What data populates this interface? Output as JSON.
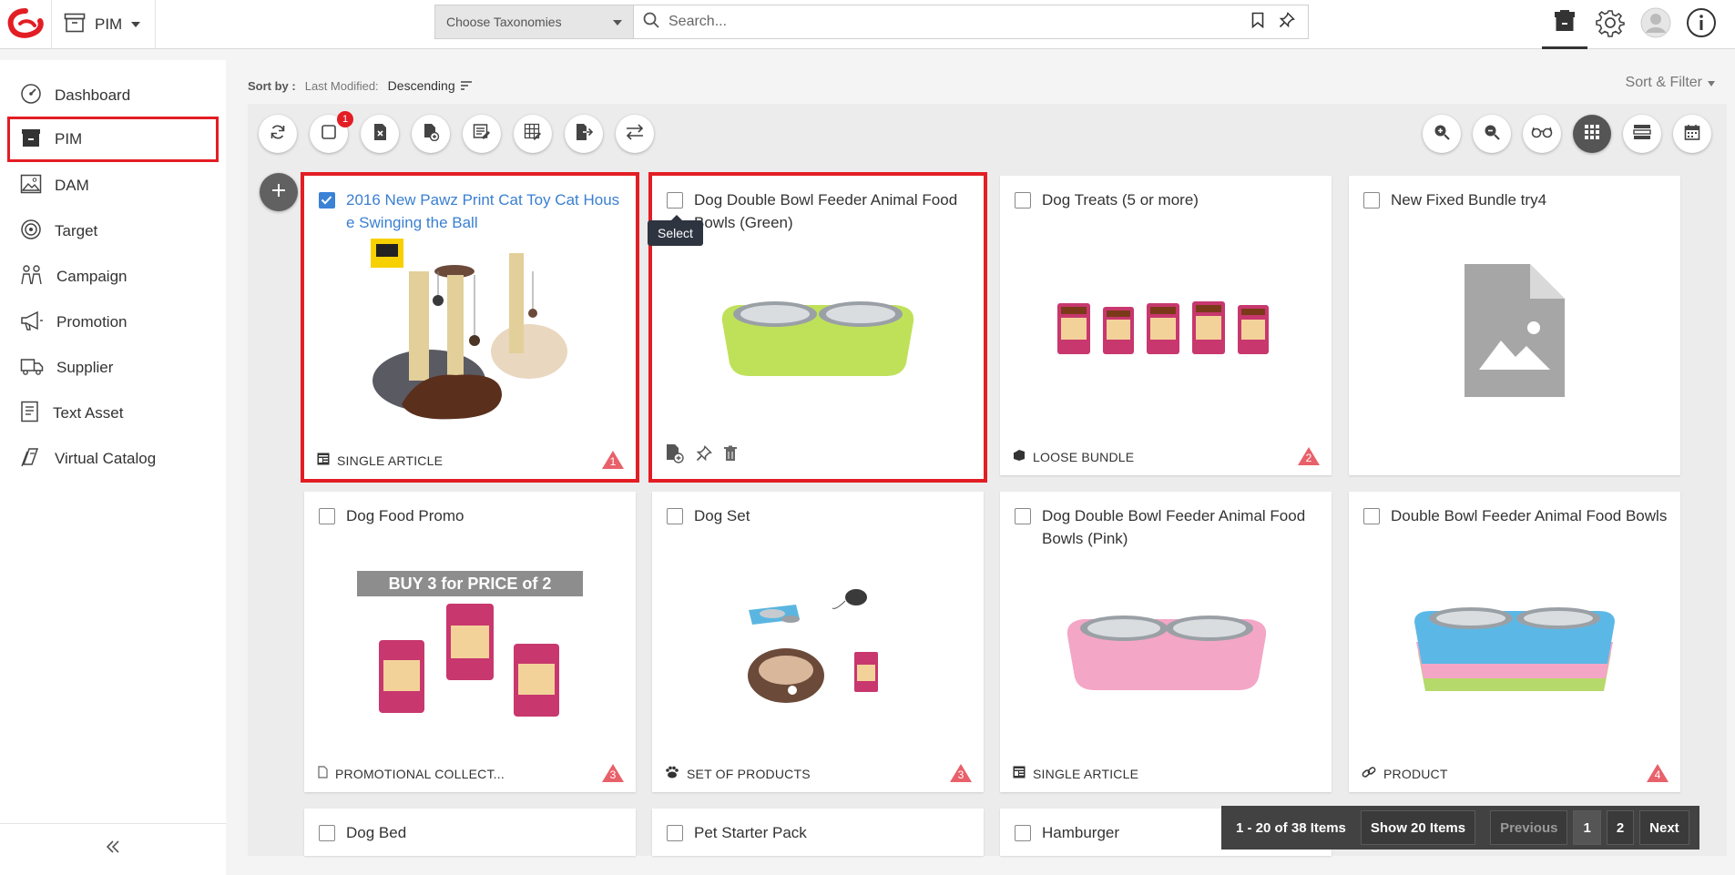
{
  "header": {
    "module_label": "PIM",
    "taxonomy_placeholder": "Choose Taxonomies",
    "search_placeholder": "Search..."
  },
  "sidebar": {
    "items": [
      {
        "label": "Dashboard",
        "icon": "dashboard-icon"
      },
      {
        "label": "PIM",
        "icon": "pim-icon",
        "selected": true
      },
      {
        "label": "DAM",
        "icon": "image-icon"
      },
      {
        "label": "Target",
        "icon": "target-icon"
      },
      {
        "label": "Campaign",
        "icon": "campaign-icon"
      },
      {
        "label": "Promotion",
        "icon": "megaphone-icon"
      },
      {
        "label": "Supplier",
        "icon": "truck-icon"
      },
      {
        "label": "Text Asset",
        "icon": "text-asset-icon"
      },
      {
        "label": "Virtual Catalog",
        "icon": "catalog-icon"
      }
    ]
  },
  "sort": {
    "label": "Sort by :",
    "field": "Last Modified:",
    "value": "Descending",
    "sort_filter_label": "Sort & Filter"
  },
  "toolbar": {
    "selected_count_badge": "1"
  },
  "tooltip": "Select",
  "cards": [
    {
      "title": "2016 New Pawz Print Cat Toy Cat House Swinging the Ball",
      "type": "SINGLE ARTICLE",
      "warning": "1",
      "checked": true
    },
    {
      "title": "Dog Double Bowl Feeder Animal Food Bowls (Green)",
      "type": "",
      "warning": "",
      "checked": false
    },
    {
      "title": "Dog Treats (5 or more)",
      "type": "LOOSE BUNDLE",
      "warning": "2",
      "checked": false
    },
    {
      "title": "New Fixed Bundle try4",
      "type": "",
      "warning": "",
      "checked": false
    },
    {
      "title": "Dog Food Promo",
      "type": "PROMOTIONAL COLLECT...",
      "warning": "3",
      "checked": false,
      "promo_banner": "BUY 3 for PRICE of 2"
    },
    {
      "title": "Dog Set",
      "type": "SET OF PRODUCTS",
      "warning": "3",
      "checked": false
    },
    {
      "title": "Dog Double Bowl Feeder Animal Food Bowls (Pink)",
      "type": "SINGLE ARTICLE",
      "warning": "",
      "checked": false
    },
    {
      "title": "Double Bowl Feeder Animal Food Bowls",
      "type": "PRODUCT",
      "warning": "4",
      "checked": false
    },
    {
      "title": "Dog Bed",
      "checked": false
    },
    {
      "title": "Pet Starter Pack",
      "checked": false
    },
    {
      "title": "Hamburger",
      "checked": false
    }
  ],
  "pager": {
    "info": "1 - 20 of 38 Items",
    "show": "Show 20 Items",
    "previous": "Previous",
    "pages": [
      "1",
      "2"
    ],
    "next": "Next"
  },
  "colors": {
    "accent_red": "#e31d24",
    "link_blue": "#3a7fd1",
    "pager_bg": "#424242"
  }
}
